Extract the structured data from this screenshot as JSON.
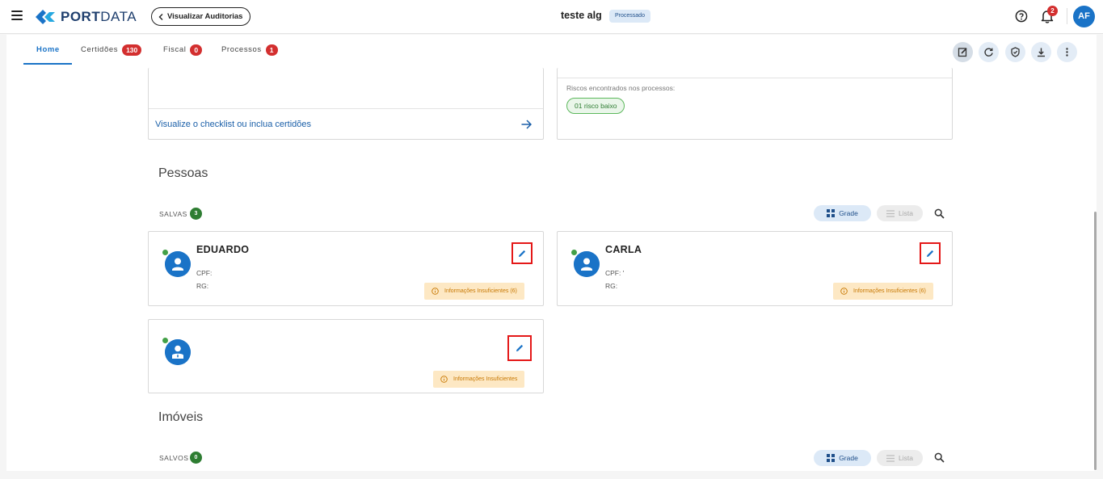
{
  "header": {
    "logo_bold": "PORT",
    "logo_light": "DATA",
    "back_label": "Visualizar Auditorias",
    "doc_title": "teste alg",
    "status": "Processado",
    "notification_count": "2",
    "user_initials": "AF"
  },
  "tabs": [
    {
      "label": "Home",
      "badge": ""
    },
    {
      "label": "Certidões",
      "badge": "130"
    },
    {
      "label": "Fiscal",
      "badge": "0"
    },
    {
      "label": "Processos",
      "badge": "1"
    }
  ],
  "top_cards": {
    "checklist_link": "Visualize o checklist ou inclua certidões",
    "risk_label": "Riscos encontrados nos processos:",
    "risk_chip": "01 risco baixo"
  },
  "pessoas": {
    "title": "Pessoas",
    "saved_label": "SALVAS",
    "saved_count": "3",
    "grade_label": "Grade",
    "lista_label": "Lista",
    "people": [
      {
        "name": "EDUARDO",
        "cpf": "CPF:",
        "rg": "RG:",
        "warning": "Informações Insuficientes (6)"
      },
      {
        "name": "CARLA",
        "cpf": "CPF: '",
        "rg": "RG:",
        "warning": "Informações Insuficientes (6)"
      },
      {
        "name": "",
        "cpf": "",
        "rg": "",
        "warning": "Informações Insuficientes"
      }
    ]
  },
  "imoveis": {
    "title": "Imóveis",
    "saved_label": "SALVOS",
    "saved_count": "0",
    "grade_label": "Grade",
    "lista_label": "Lista"
  },
  "colors": {
    "accent": "#1a73c7",
    "badge_red": "#d32f2f",
    "success_green": "#2e7d32",
    "warning_bg": "#fde8c4",
    "warning_text": "#c77700",
    "highlight_red": "#e41818"
  }
}
